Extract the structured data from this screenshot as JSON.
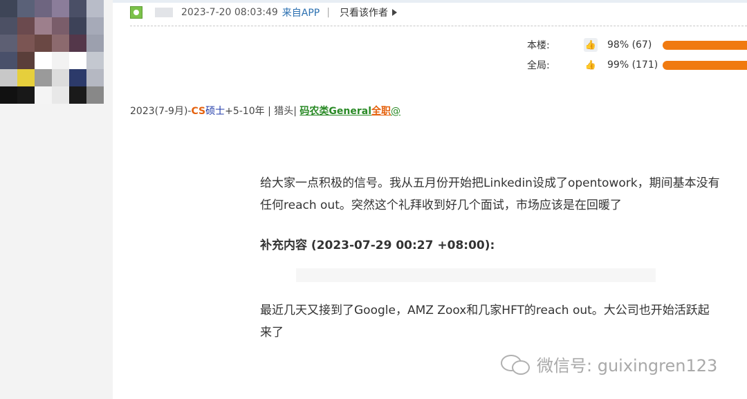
{
  "post_header": {
    "timestamp": "2023-7-20 08:03:49",
    "source": "来自APP",
    "separator": "|",
    "author_only": "只看该作者"
  },
  "rating": {
    "floor_label": "本楼:",
    "floor_value": "98% (67)",
    "floor_percent": 98,
    "global_label": "全局:",
    "global_value": "99% (171)",
    "global_percent": 99
  },
  "tags": {
    "date": "2023(7-9月)-",
    "major": "CS",
    "degree": "硕士",
    "experience": "+5-10年 | 猎头|",
    "category": "码农类General",
    "type": "全职",
    "at": "@"
  },
  "content": {
    "paragraph1": "给大家一点积极的信号。我从五月份开始把Linkedin设成了opentowork，期间基本没有任何reach out。突然这个礼拜收到好几个面试，市场应该是在回暖了",
    "supplement_header": "补充内容 (2023-07-29 00:27 +08:00):",
    "paragraph2": "最近几天又接到了Google，AMZ Zoox和几家HFT的reach out。大公司也开始活跃起来了"
  },
  "watermark": {
    "text": "微信号: guixingren123"
  },
  "colors": {
    "accent_orange": "#f07a10",
    "link_blue": "#2a6fb0",
    "category_green": "#2a8a26",
    "degree_blue": "#1f3aa8"
  },
  "icons": {
    "user": "user-icon",
    "arrow": "triangle-right-icon",
    "thumb": "thumbs-up-icon",
    "wechat": "wechat-icon"
  }
}
